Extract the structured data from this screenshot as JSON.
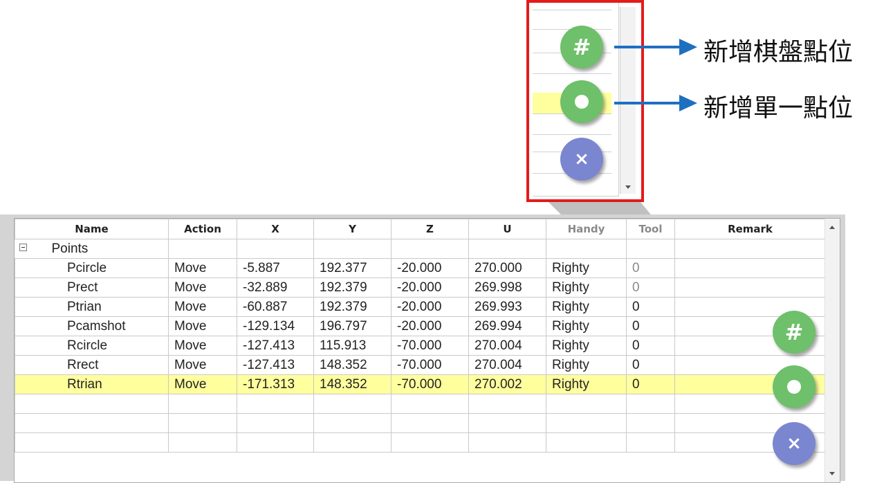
{
  "callout": {
    "label_chessboard": "新增棋盤點位",
    "label_single": "新增單一點位"
  },
  "buttons": {
    "add_grid_icon": "hash-icon",
    "add_single_icon": "circle-icon",
    "delete_icon": "close-icon",
    "glyph_hash": "#",
    "glyph_x": "×"
  },
  "colors": {
    "callout_border": "#e31b1b",
    "arrow": "#1f6fc0",
    "green_button": "#6ec06a",
    "blue_button": "#7b86d0",
    "selected_row": "#ffff9e"
  },
  "table": {
    "columns": [
      "Name",
      "Action",
      "X",
      "Y",
      "Z",
      "U",
      "Handy",
      "Tool",
      "Remark"
    ],
    "group": {
      "label": "Points",
      "expanded": true
    },
    "rows": [
      {
        "name": "Pcircle",
        "action": "Move",
        "x": "-5.887",
        "y": "192.377",
        "z": "-20.000",
        "u": "270.000",
        "handy": "Righty",
        "tool": "0",
        "remark": ""
      },
      {
        "name": "Prect",
        "action": "Move",
        "x": "-32.889",
        "y": "192.379",
        "z": "-20.000",
        "u": "269.998",
        "handy": "Righty",
        "tool": "0",
        "remark": ""
      },
      {
        "name": "Ptrian",
        "action": "Move",
        "x": "-60.887",
        "y": "192.379",
        "z": "-20.000",
        "u": "269.993",
        "handy": "Righty",
        "tool": "0",
        "remark": ""
      },
      {
        "name": "Pcamshot",
        "action": "Move",
        "x": "-129.134",
        "y": "196.797",
        "z": "-20.000",
        "u": "269.994",
        "handy": "Righty",
        "tool": "0",
        "remark": ""
      },
      {
        "name": "Rcircle",
        "action": "Move",
        "x": "-127.413",
        "y": "115.913",
        "z": "-70.000",
        "u": "270.004",
        "handy": "Righty",
        "tool": "0",
        "remark": ""
      },
      {
        "name": "Rrect",
        "action": "Move",
        "x": "-127.413",
        "y": "148.352",
        "z": "-70.000",
        "u": "270.004",
        "handy": "Righty",
        "tool": "0",
        "remark": ""
      },
      {
        "name": "Rtrian",
        "action": "Move",
        "x": "-171.313",
        "y": "148.352",
        "z": "-70.000",
        "u": "270.002",
        "handy": "Righty",
        "tool": "0",
        "remark": ""
      }
    ],
    "selected_row": 6
  }
}
